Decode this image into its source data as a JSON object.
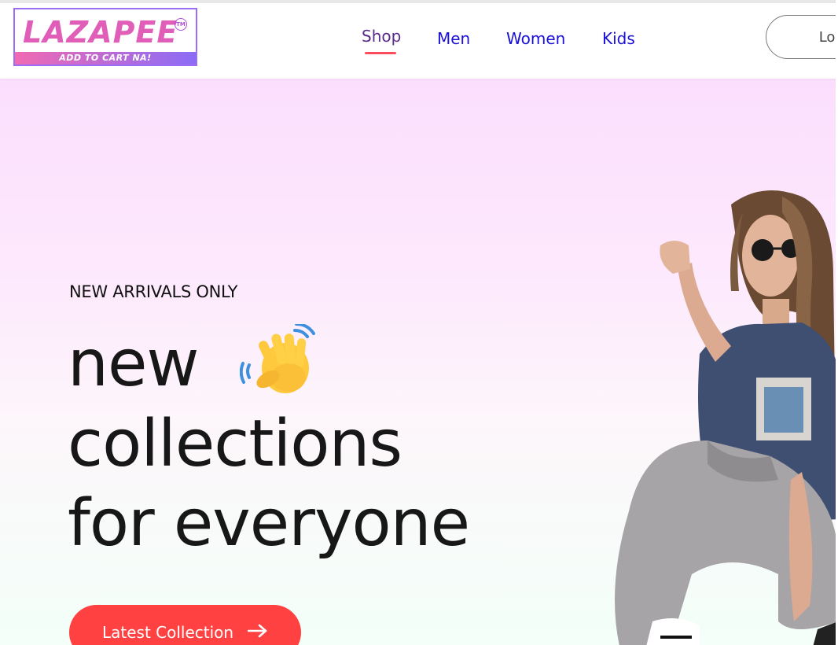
{
  "brand": {
    "name": "LAZAPEE",
    "trademark": "TM",
    "tagline": "ADD TO CART NA!"
  },
  "nav": {
    "items": [
      {
        "label": "Shop",
        "active": true
      },
      {
        "label": "Men",
        "active": false
      },
      {
        "label": "Women",
        "active": false
      },
      {
        "label": "Kids",
        "active": false
      }
    ],
    "login_label": "Login"
  },
  "hero": {
    "eyebrow": "NEW ARRIVALS ONLY",
    "headline_line1": "new",
    "headline_line2": "collections",
    "headline_line3": "for everyone",
    "emoji": "waving-hand",
    "cta_label": "Latest Collection",
    "cta_icon": "arrow-right-icon"
  },
  "colors": {
    "accent": "#ff4141",
    "nav_link": "#1a10d8",
    "nav_active": "#5a2a8a",
    "underline": "#ff4d5e",
    "logo_pink": "#e05db8",
    "logo_purple": "#8b6cf6",
    "hero_top": "#fbdefd",
    "hero_bottom": "#f3fff8"
  }
}
